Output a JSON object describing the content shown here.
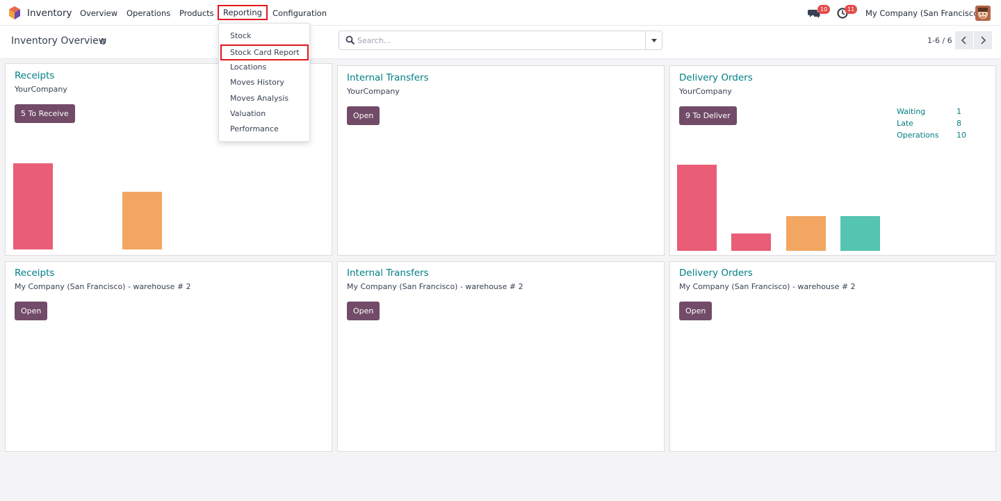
{
  "navbar": {
    "app_name": "Inventory",
    "menu": [
      "Overview",
      "Operations",
      "Products",
      "Reporting",
      "Configuration"
    ],
    "messages_badge": "10",
    "activities_badge": "11",
    "company": "My Company (San Francisco)"
  },
  "control_panel": {
    "title": "Inventory Overview",
    "search_placeholder": "Search...",
    "pager": "1-6 / 6"
  },
  "reporting_menu": {
    "items": [
      "Stock",
      "Stock Card Report",
      "Locations",
      "Moves History",
      "Moves Analysis",
      "Valuation",
      "Performance"
    ],
    "highlighted": "Stock Card Report"
  },
  "cards": [
    {
      "title": "Receipts",
      "subtitle": "YourCompany",
      "button": "5 To Receive",
      "graph": [
        {
          "value": 1.0,
          "color": "#e95e76"
        },
        {
          "value": 0,
          "color": "#e95e76"
        },
        {
          "value": 0.67,
          "color": "#f2a662"
        },
        {
          "value": 0,
          "color": "#55c4b0"
        }
      ]
    },
    {
      "title": "Internal Transfers",
      "subtitle": "YourCompany",
      "button": "Open"
    },
    {
      "title": "Delivery Orders",
      "subtitle": "YourCompany",
      "button": "9 To Deliver",
      "stats": [
        {
          "label": "Waiting",
          "value": "1"
        },
        {
          "label": "Late",
          "value": "8"
        },
        {
          "label": "Operations",
          "value": "10"
        }
      ],
      "graph": [
        {
          "value": 1.0,
          "color": "#e95e76"
        },
        {
          "value": 0.2,
          "color": "#e95e76"
        },
        {
          "value": 0.4,
          "color": "#f2a662"
        },
        {
          "value": 0.4,
          "color": "#55c4b0"
        }
      ]
    },
    {
      "title": "Receipts",
      "subtitle": "My Company (San Francisco) - warehouse # 2",
      "button": "Open"
    },
    {
      "title": "Internal Transfers",
      "subtitle": "My Company (San Francisco) - warehouse # 2",
      "button": "Open"
    },
    {
      "title": "Delivery Orders",
      "subtitle": "My Company (San Francisco) - warehouse # 2",
      "button": "Open"
    }
  ],
  "colors": {
    "brand": "#714b67",
    "title_teal": "#017e84",
    "highlight_red": "#e3141f"
  }
}
